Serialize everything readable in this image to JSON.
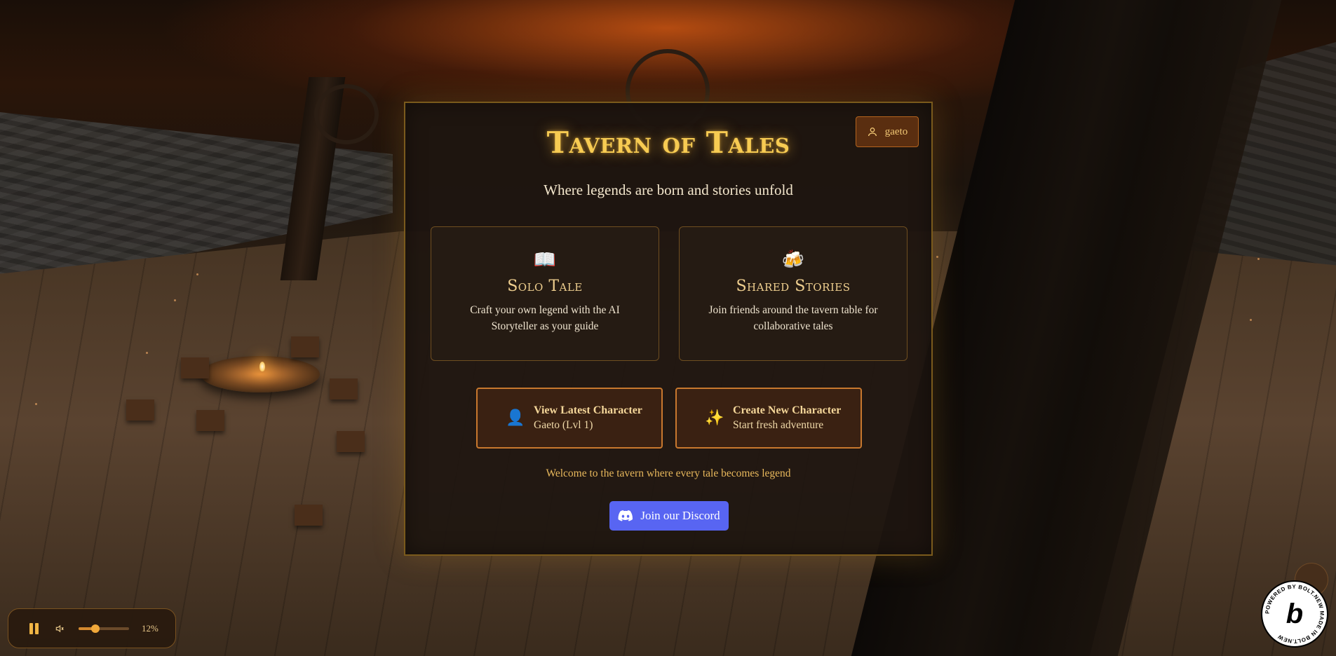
{
  "header": {
    "user_label": "gaeto",
    "title": "Tavern of Tales",
    "subtitle": "Where legends are born and stories unfold"
  },
  "modes": [
    {
      "icon": "open-book-icon",
      "glyph": "📖",
      "title": "Solo Tale",
      "description": "Craft your own legend with the AI Storyteller as your guide"
    },
    {
      "icon": "beer-mugs-icon",
      "glyph": "🍻",
      "title": "Shared Stories",
      "description": "Join friends around the tavern table for collaborative tales"
    }
  ],
  "characters": {
    "view": {
      "icon": "person-icon",
      "glyph": "👤",
      "label": "View Latest Character",
      "sub": "Gaeto (Lvl 1)"
    },
    "create": {
      "icon": "sparkles-icon",
      "glyph": "✨",
      "label": "Create New Character",
      "sub": "Start fresh adventure"
    }
  },
  "welcome": "Welcome to the tavern where every tale becomes legend",
  "discord": {
    "label": "Join our Discord",
    "color": "#5865f2"
  },
  "player": {
    "volume_label": "12%",
    "volume": 0.33
  },
  "badge": {
    "text": "POWERED BY BOLT.NEW MADE IN BOLT.NEW"
  },
  "colors": {
    "accent": "#f7cb52",
    "panel_border": "#7a5a1c",
    "button_border": "#c8782e"
  }
}
